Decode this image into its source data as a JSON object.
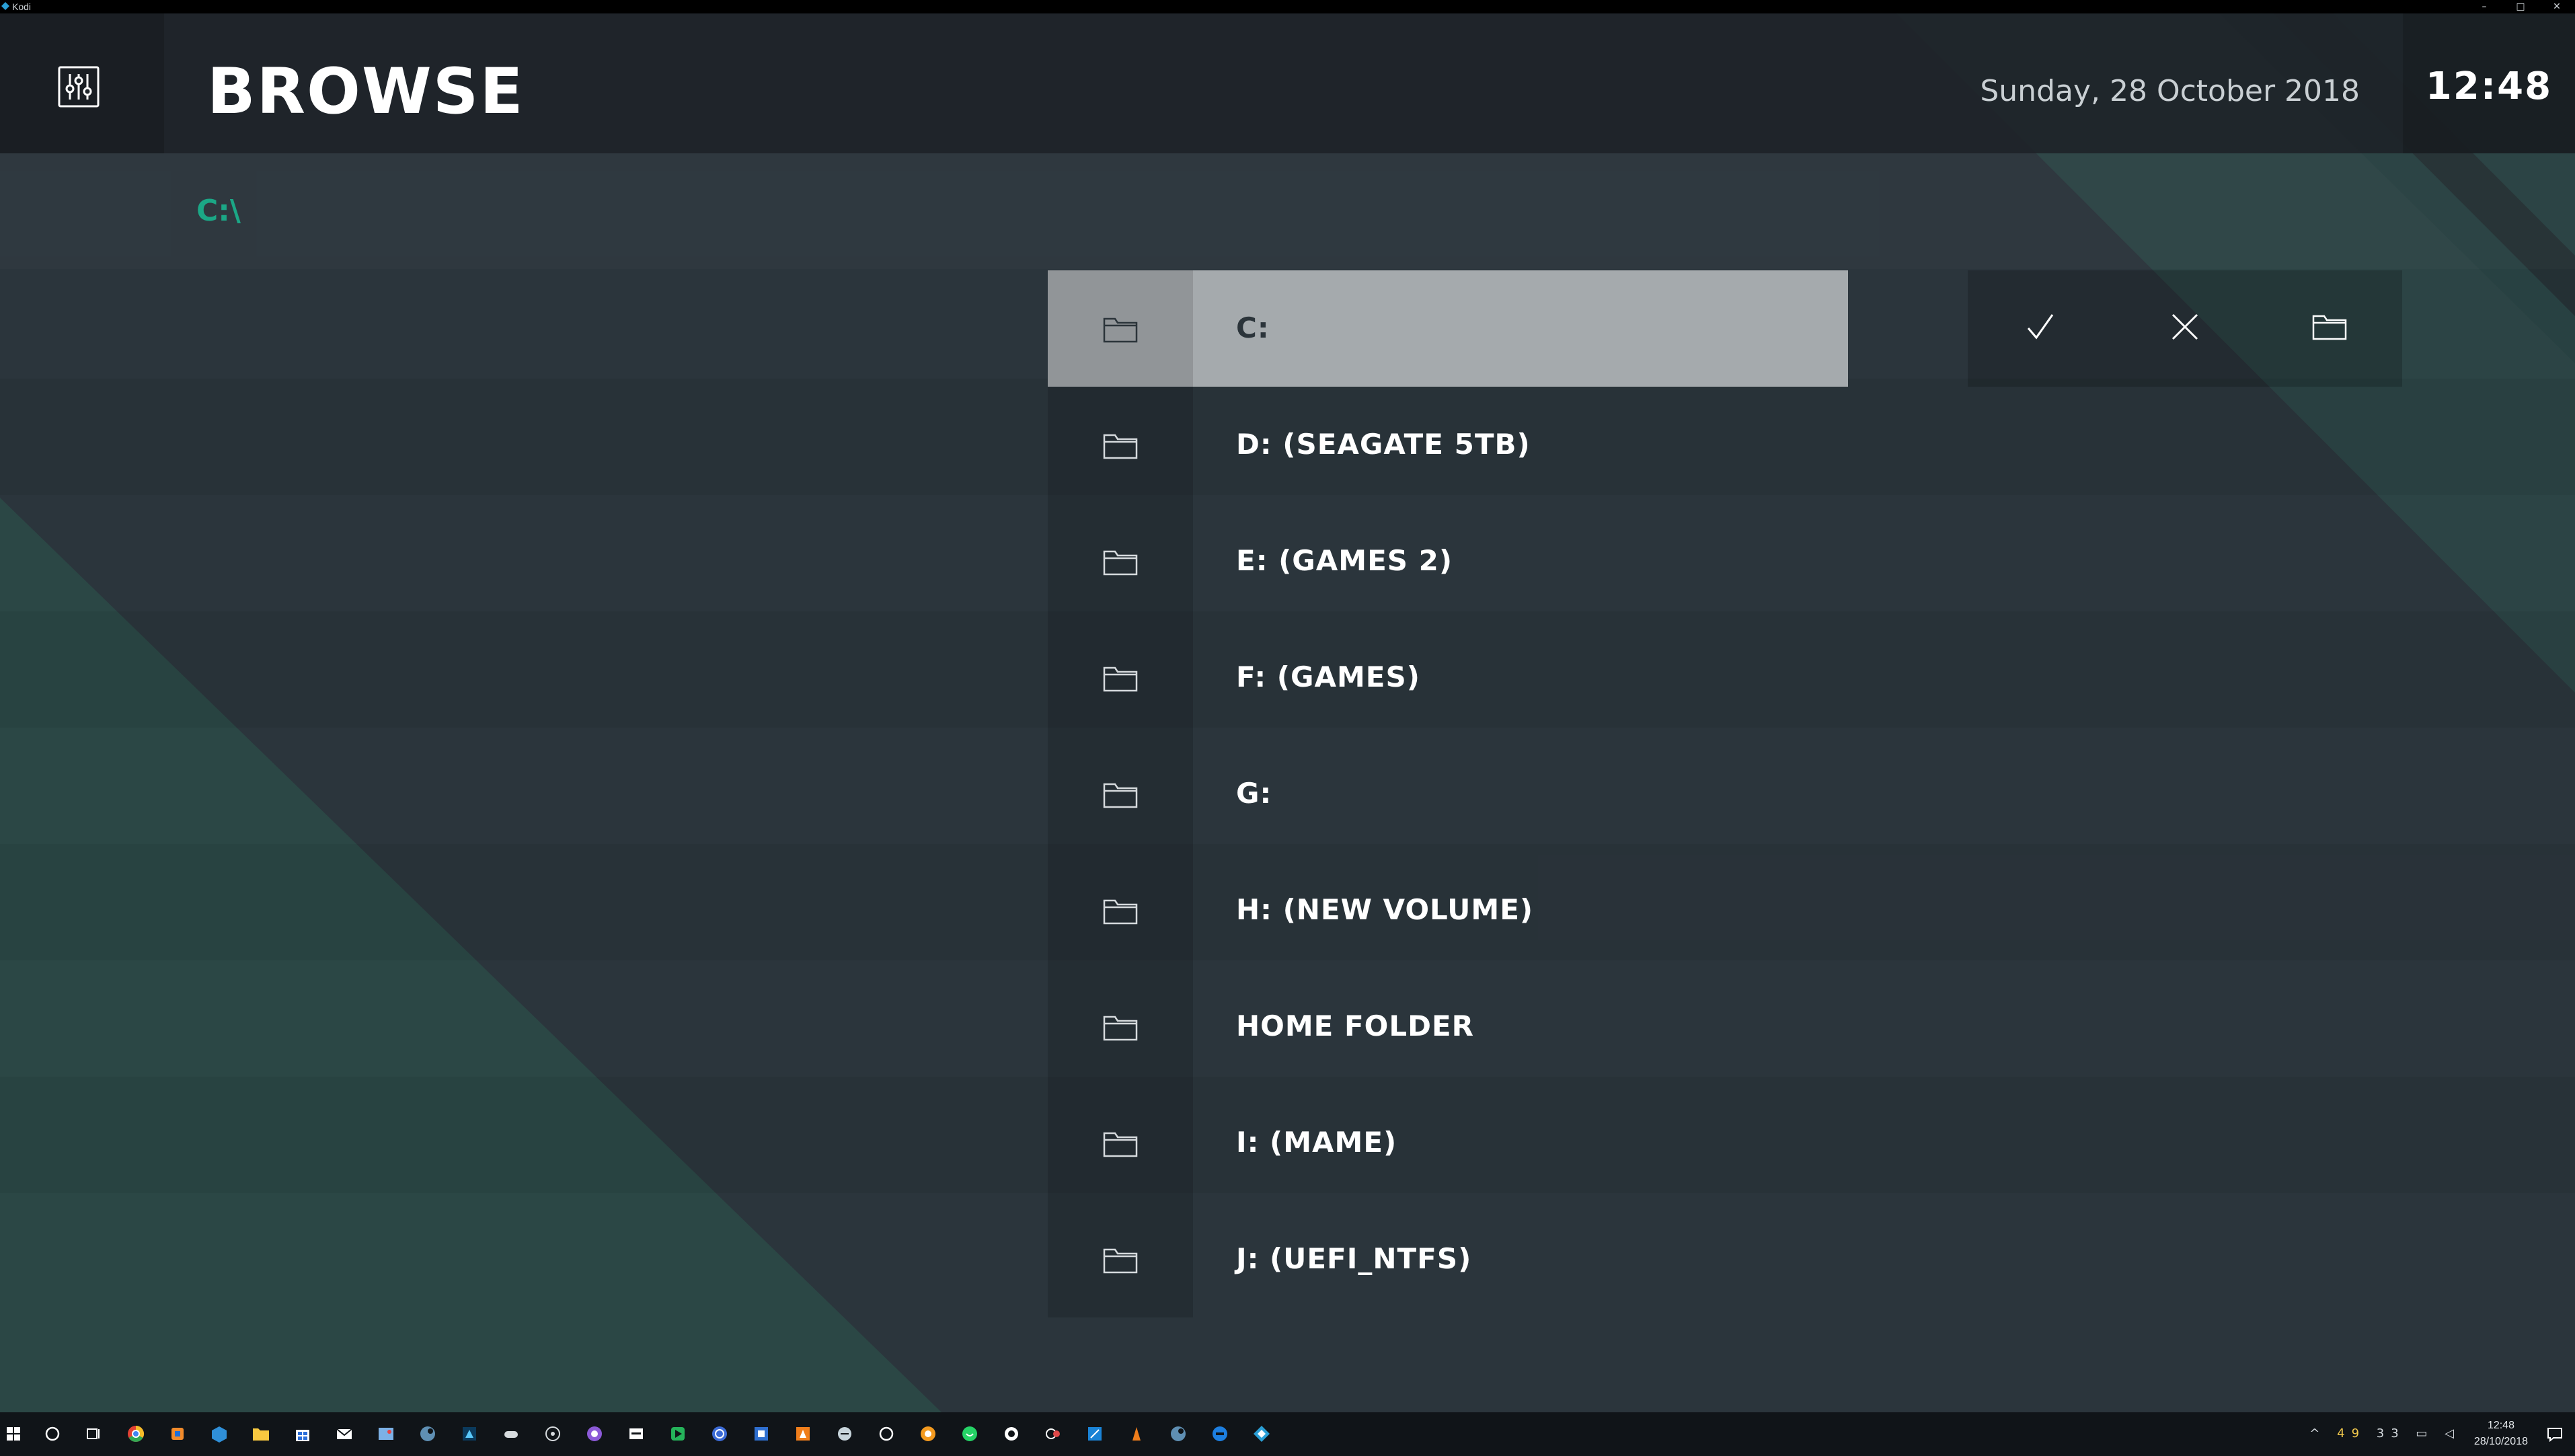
{
  "window": {
    "app_name": "Kodi",
    "minimize_glyph": "–",
    "restore_glyph": "□",
    "close_glyph": "✕"
  },
  "header": {
    "title": "BROWSE",
    "date": "Sunday, 28 October 2018",
    "time": "12:48",
    "settings_icon": "settings-sliders-icon"
  },
  "path": {
    "current": "C:\\"
  },
  "file_list": {
    "items": [
      {
        "label": "C:",
        "focused": true
      },
      {
        "label": "D: (SEAGATE 5TB)"
      },
      {
        "label": "E: (GAMES 2)"
      },
      {
        "label": "F: (GAMES)"
      },
      {
        "label": "G:"
      },
      {
        "label": "H: (NEW VOLUME)"
      },
      {
        "label": "HOME FOLDER"
      },
      {
        "label": "I: (MAME)"
      },
      {
        "label": "J: (UEFI_NTFS)"
      }
    ],
    "item_icon": "folder-icon"
  },
  "actions": [
    {
      "name": "ok",
      "icon": "checkmark-icon"
    },
    {
      "name": "cancel",
      "icon": "close-icon"
    },
    {
      "name": "new-folder",
      "icon": "folder-icon"
    }
  ],
  "taskbar": {
    "tray_time": "12:48",
    "tray_date": "28/10/2018",
    "tray_temp_1": "49",
    "tray_temp_2": "33"
  },
  "colors": {
    "accent": "#1ba786",
    "background": "#2b353c",
    "header": "#1e2429",
    "focused_row": "#a5aaad",
    "teal_shape": "#2b4a47"
  }
}
